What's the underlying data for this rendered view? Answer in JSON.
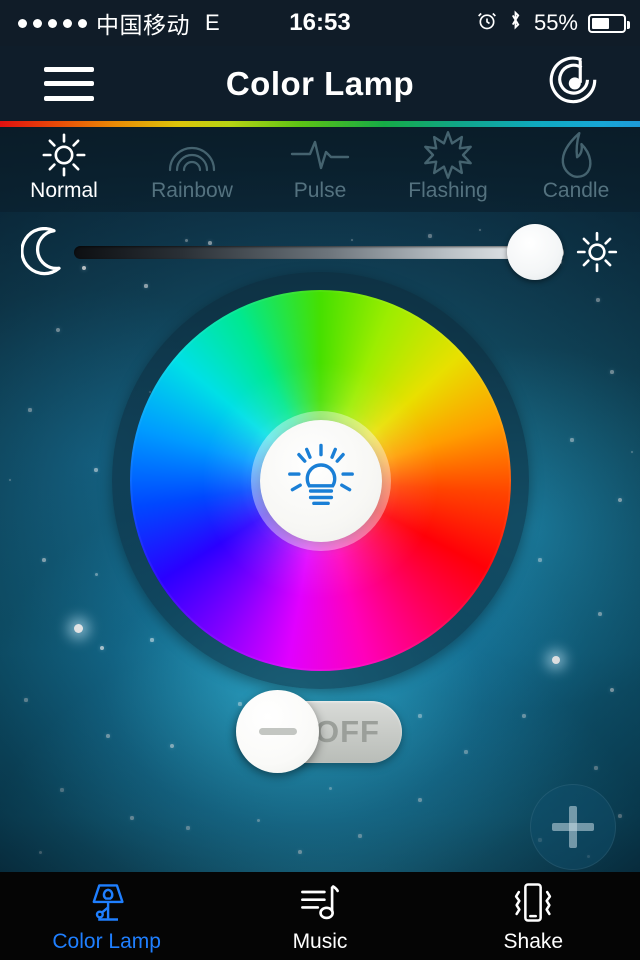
{
  "status_bar": {
    "signal_dots": 5,
    "carrier": "中国移动",
    "network": "E",
    "time": "16:53",
    "alarm_icon": "alarm-clock-icon",
    "bluetooth_icon": "bluetooth-icon",
    "battery_percent": "55%",
    "battery_level": 55
  },
  "header": {
    "menu_icon": "hamburger-menu-icon",
    "title": "Color Lamp",
    "music_icon": "music-disc-icon"
  },
  "modes": {
    "items": [
      {
        "label": "Normal",
        "icon": "sun-icon",
        "active": true
      },
      {
        "label": "Rainbow",
        "icon": "rainbow-icon",
        "active": false
      },
      {
        "label": "Pulse",
        "icon": "pulse-wave-icon",
        "active": false
      },
      {
        "label": "Flashing",
        "icon": "starburst-icon",
        "active": false
      },
      {
        "label": "Candle",
        "icon": "flame-icon",
        "active": false
      }
    ]
  },
  "brightness": {
    "min_icon": "moon-icon",
    "max_icon": "sun-icon",
    "value_percent": 94
  },
  "color_wheel": {
    "center_icon": "light-bulb-icon",
    "selected_hue": null
  },
  "power_toggle": {
    "state_label": "OFF",
    "is_on": false,
    "knob_icon": "minus-dash-icon"
  },
  "fab": {
    "icon": "plus-icon"
  },
  "tabbar": {
    "items": [
      {
        "label": "Color Lamp",
        "icon": "table-lamp-icon",
        "active": true
      },
      {
        "label": "Music",
        "icon": "music-note-icon",
        "active": false
      },
      {
        "label": "Shake",
        "icon": "shake-phone-icon",
        "active": false
      }
    ]
  },
  "colors": {
    "accent_blue": "#1f7fff",
    "header_bg": "#0f1d2a",
    "status_bg": "#101c28",
    "tabbar_bg": "#050505",
    "inactive_text": "#54727f"
  }
}
